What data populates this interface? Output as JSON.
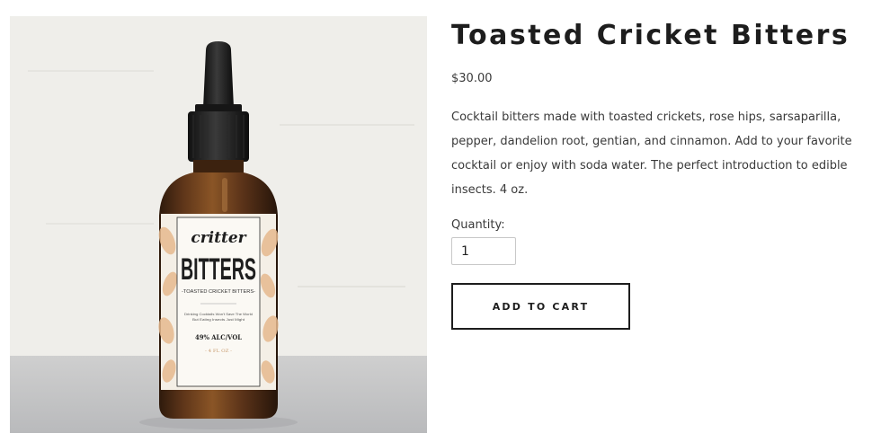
{
  "product": {
    "image": {
      "label_brand_top": "critter",
      "label_brand_main": "BITTERS",
      "label_subtitle": "-TOASTED CRICKET BITTERS-",
      "label_fine_print_1": "Drinking Cocktails Won't Save The World",
      "label_fine_print_2": "But Eating Insects Just Might",
      "label_abv": "49% ALC/VOL",
      "label_volume": "- 4 FL OZ -"
    },
    "title": "Toasted Cricket Bitters",
    "price": "$30.00",
    "description": "Cocktail bitters made with toasted crickets, rose hips, sarsaparilla, pepper, dandelion root, gentian, and cinnamon. Add to your favorite cocktail or enjoy with soda water. The perfect introduction to edible insects. 4 oz.",
    "quantity_label": "Quantity:",
    "quantity_value": "1",
    "add_to_cart_label": "ADD TO CART"
  },
  "colors": {
    "text": "#3a3a3a",
    "heading": "#1d1d1d",
    "amber_glass": "#5a3418",
    "label_accent": "#e6b98e"
  }
}
